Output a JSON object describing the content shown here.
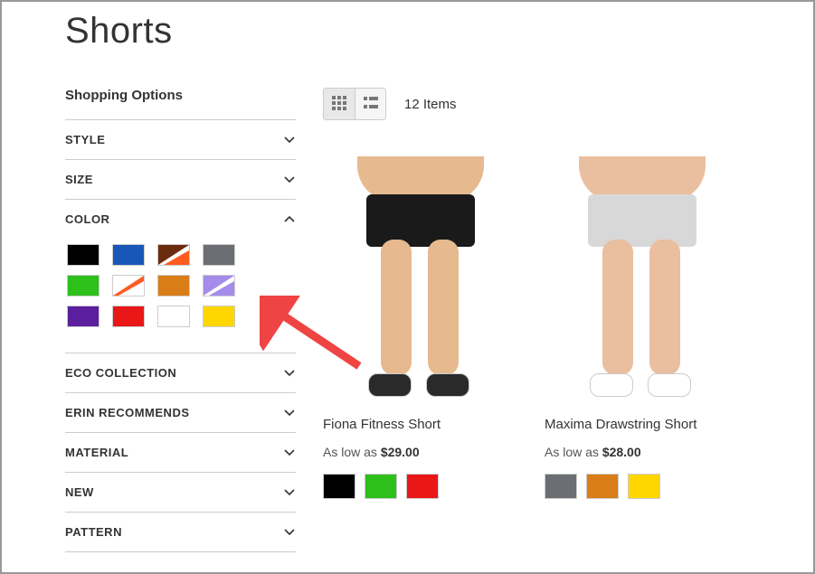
{
  "page_title": "Shorts",
  "sidebar": {
    "title": "Shopping Options",
    "filters": [
      {
        "label": "STYLE",
        "expanded": false
      },
      {
        "label": "SIZE",
        "expanded": false
      },
      {
        "label": "COLOR",
        "expanded": true
      },
      {
        "label": "ECO COLLECTION",
        "expanded": false
      },
      {
        "label": "ERIN RECOMMENDS",
        "expanded": false
      },
      {
        "label": "MATERIAL",
        "expanded": false
      },
      {
        "label": "NEW",
        "expanded": false
      },
      {
        "label": "PATTERN",
        "expanded": false
      }
    ],
    "color_swatches": [
      {
        "name": "black",
        "color": "#000000"
      },
      {
        "name": "blue",
        "color": "#1857b8"
      },
      {
        "name": "brown-multi",
        "multi": true,
        "c1": "#6b2b0f",
        "c2": "#ffffff",
        "c3": "#ff5a1f"
      },
      {
        "name": "gray",
        "color": "#6b6e72"
      },
      {
        "name": "green",
        "color": "#2dbf1a"
      },
      {
        "name": "white-multi",
        "multi": true,
        "c1": "#ffffff",
        "c2": "#ff5a1f",
        "c3": "#ffffff"
      },
      {
        "name": "orange",
        "color": "#d97d19"
      },
      {
        "name": "lavender-multi",
        "multi": true,
        "c1": "#a58cea",
        "c2": "#ffffff",
        "c3": "#a58cea"
      },
      {
        "name": "purple",
        "color": "#5b1f9e"
      },
      {
        "name": "red",
        "color": "#e91717"
      },
      {
        "name": "white",
        "color": "#ffffff"
      },
      {
        "name": "yellow",
        "color": "#ffd600"
      }
    ]
  },
  "toolbar": {
    "item_count": "12 Items"
  },
  "products": [
    {
      "name": "Fiona Fitness Short",
      "price_prefix": "As low as ",
      "price": "$29.00",
      "swatches": [
        {
          "name": "black",
          "color": "#000000"
        },
        {
          "name": "green",
          "color": "#2dbf1a"
        },
        {
          "name": "red",
          "color": "#e91717"
        }
      ],
      "placeholder": {
        "skin": "#e6b98f",
        "short": "#1a1a1a",
        "shoe": "#2a2a2a"
      }
    },
    {
      "name": "Maxima Drawstring Short",
      "price_prefix": "As low as ",
      "price": "$28.00",
      "swatches": [
        {
          "name": "gray",
          "color": "#6b6e72"
        },
        {
          "name": "orange",
          "color": "#d97d19"
        },
        {
          "name": "yellow",
          "color": "#ffd600"
        }
      ],
      "placeholder": {
        "skin": "#e9bfa0",
        "short": "#d8d8d8",
        "shoe": "#ffffff"
      }
    }
  ]
}
